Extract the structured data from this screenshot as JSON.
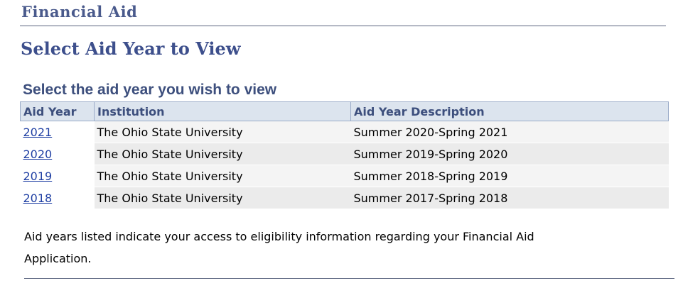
{
  "header": {
    "section_title": "Financial Aid",
    "page_title": "Select Aid Year to View"
  },
  "aid_grid": {
    "caption": "Select the aid year you wish to view",
    "columns": {
      "aid_year": "Aid Year",
      "institution": "Institution",
      "description": "Aid Year Description"
    },
    "rows": [
      {
        "aid_year": "2021",
        "institution": "The Ohio State University",
        "description": "Summer 2020-Spring 2021"
      },
      {
        "aid_year": "2020",
        "institution": "The Ohio State University",
        "description": "Summer 2019-Spring 2020"
      },
      {
        "aid_year": "2019",
        "institution": "The Ohio State University",
        "description": "Summer 2018-Spring 2019"
      },
      {
        "aid_year": "2018",
        "institution": "The Ohio State University",
        "description": "Summer 2017-Spring 2018"
      }
    ]
  },
  "footnote": "Aid years listed indicate your access to eligibility information regarding your Financial Aid Application.",
  "colors": {
    "title_color": "#4a5a8c",
    "link_color": "#1f3fa3",
    "header_bg": "#dce4ee"
  }
}
